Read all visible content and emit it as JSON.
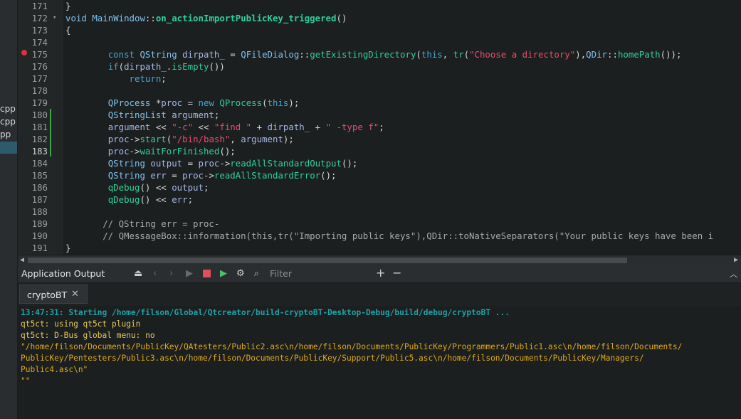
{
  "sidebar": {
    "items": [
      "cpp",
      "cpp",
      "pp",
      ""
    ]
  },
  "editor": {
    "lines": [
      {
        "num": "171",
        "fold": "",
        "tokens": [
          [
            "o",
            "}"
          ]
        ]
      },
      {
        "num": "172",
        "fold": "▾",
        "tokens": [
          [
            "t",
            "void"
          ],
          [
            "o",
            " "
          ],
          [
            "t",
            "MainWindow"
          ],
          [
            "o",
            "::"
          ],
          [
            "fb",
            "on_actionImportPublicKey_triggered"
          ],
          [
            "o",
            "()"
          ]
        ]
      },
      {
        "num": "173",
        "fold": "",
        "tokens": [
          [
            "o",
            "{"
          ]
        ]
      },
      {
        "num": "174",
        "fold": "",
        "tokens": []
      },
      {
        "num": "175",
        "fold": "",
        "tokens": [
          [
            "o",
            "        "
          ],
          [
            "k",
            "const"
          ],
          [
            "o",
            " "
          ],
          [
            "t",
            "QString"
          ],
          [
            "o",
            " "
          ],
          [
            "v",
            "dirpath_"
          ],
          [
            "o",
            " = "
          ],
          [
            "t",
            "QFileDialog"
          ],
          [
            "o",
            "::"
          ],
          [
            "f",
            "getExistingDirectory"
          ],
          [
            "o",
            "("
          ],
          [
            "k",
            "this"
          ],
          [
            "o",
            ", "
          ],
          [
            "f",
            "tr"
          ],
          [
            "o",
            "("
          ],
          [
            "s",
            "\"Choose a directory\""
          ],
          [
            "o",
            "),"
          ],
          [
            "t",
            "QDir"
          ],
          [
            "o",
            "::"
          ],
          [
            "f",
            "homePath"
          ],
          [
            "o",
            "());"
          ]
        ]
      },
      {
        "num": "176",
        "fold": "",
        "tokens": [
          [
            "o",
            "        "
          ],
          [
            "k",
            "if"
          ],
          [
            "o",
            "("
          ],
          [
            "v",
            "dirpath_"
          ],
          [
            "o",
            "."
          ],
          [
            "f",
            "isEmpty"
          ],
          [
            "o",
            "())"
          ]
        ]
      },
      {
        "num": "177",
        "fold": "",
        "tokens": [
          [
            "o",
            "            "
          ],
          [
            "k",
            "return"
          ],
          [
            "o",
            ";"
          ]
        ]
      },
      {
        "num": "178",
        "fold": "",
        "tokens": []
      },
      {
        "num": "179",
        "fold": "",
        "tokens": [
          [
            "o",
            "        "
          ],
          [
            "t",
            "QProcess"
          ],
          [
            "o",
            " *"
          ],
          [
            "v",
            "proc"
          ],
          [
            "o",
            " = "
          ],
          [
            "k",
            "new"
          ],
          [
            "o",
            " "
          ],
          [
            "f",
            "QProcess"
          ],
          [
            "o",
            "("
          ],
          [
            "k",
            "this"
          ],
          [
            "o",
            ");"
          ]
        ]
      },
      {
        "num": "180",
        "fold": "",
        "tokens": [
          [
            "o",
            "        "
          ],
          [
            "t",
            "QStringList"
          ],
          [
            "o",
            " "
          ],
          [
            "v",
            "argument"
          ],
          [
            "o",
            ";"
          ]
        ]
      },
      {
        "num": "181",
        "fold": "",
        "tokens": [
          [
            "o",
            "        "
          ],
          [
            "v",
            "argument"
          ],
          [
            "o",
            " << "
          ],
          [
            "s",
            "\"-c\""
          ],
          [
            "o",
            " << "
          ],
          [
            "s",
            "\"find \""
          ],
          [
            "o",
            " + "
          ],
          [
            "v",
            "dirpath_"
          ],
          [
            "o",
            " + "
          ],
          [
            "s",
            "\" -type f\""
          ],
          [
            "o",
            ";"
          ]
        ]
      },
      {
        "num": "182",
        "fold": "",
        "tokens": [
          [
            "o",
            "        "
          ],
          [
            "v",
            "proc"
          ],
          [
            "o",
            "->"
          ],
          [
            "f",
            "start"
          ],
          [
            "o",
            "("
          ],
          [
            "s",
            "\"/bin/bash\""
          ],
          [
            "o",
            ", "
          ],
          [
            "v",
            "argument"
          ],
          [
            "o",
            ");"
          ]
        ]
      },
      {
        "num": "183",
        "fold": "",
        "tokens": [
          [
            "o",
            "        "
          ],
          [
            "v",
            "proc"
          ],
          [
            "o",
            "->"
          ],
          [
            "f",
            "waitForFinished"
          ],
          [
            "o",
            "();"
          ]
        ]
      },
      {
        "num": "184",
        "fold": "",
        "tokens": [
          [
            "o",
            "        "
          ],
          [
            "t",
            "QString"
          ],
          [
            "o",
            " "
          ],
          [
            "v",
            "output"
          ],
          [
            "o",
            " = "
          ],
          [
            "v",
            "proc"
          ],
          [
            "o",
            "->"
          ],
          [
            "f",
            "readAllStandardOutput"
          ],
          [
            "o",
            "();"
          ]
        ]
      },
      {
        "num": "185",
        "fold": "",
        "tokens": [
          [
            "o",
            "        "
          ],
          [
            "t",
            "QString"
          ],
          [
            "o",
            " "
          ],
          [
            "v",
            "err"
          ],
          [
            "o",
            " = "
          ],
          [
            "v",
            "proc"
          ],
          [
            "o",
            "->"
          ],
          [
            "f",
            "readAllStandardError"
          ],
          [
            "o",
            "();"
          ]
        ]
      },
      {
        "num": "186",
        "fold": "",
        "tokens": [
          [
            "o",
            "        "
          ],
          [
            "f",
            "qDebug"
          ],
          [
            "o",
            "() << "
          ],
          [
            "v",
            "output"
          ],
          [
            "o",
            ";"
          ]
        ]
      },
      {
        "num": "187",
        "fold": "",
        "tokens": [
          [
            "o",
            "        "
          ],
          [
            "f",
            "qDebug"
          ],
          [
            "o",
            "() << "
          ],
          [
            "v",
            "err"
          ],
          [
            "o",
            ";"
          ]
        ]
      },
      {
        "num": "188",
        "fold": "",
        "tokens": []
      },
      {
        "num": "189",
        "fold": "",
        "tokens": [
          [
            "o",
            "       "
          ],
          [
            "c",
            "// QString err = proc-"
          ]
        ]
      },
      {
        "num": "190",
        "fold": "",
        "tokens": [
          [
            "o",
            "       "
          ],
          [
            "c",
            "// QMessageBox::information(this,tr(\"Importing public keys\"),QDir::toNativeSeparators(\"Your public keys have been i"
          ]
        ]
      },
      {
        "num": "191",
        "fold": "",
        "tokens": [
          [
            "o",
            "}"
          ]
        ]
      }
    ]
  },
  "output_panel": {
    "title": "Application Output",
    "filter_placeholder": "Filter",
    "tab_label": "cryptoBT",
    "close_glyph": "✕",
    "lines": [
      {
        "cls": "o-start",
        "text": "13:47:31: Starting /home/filson/Global/Qtcreator/build-cryptoBT-Desktop-Debug/build/debug/cryptoBT ..."
      },
      {
        "cls": "o-norm",
        "text": "qt5ct: using qt5ct plugin"
      },
      {
        "cls": "o-norm",
        "text": "qt5ct: D-Bus global menu: no"
      },
      {
        "cls": "o-res",
        "text": "\"/home/filson/Documents/PublicKey/QAtesters/Public2.asc\\n/home/filson/Documents/PublicKey/Programmers/Public1.asc\\n/home/filson/Documents/"
      },
      {
        "cls": "o-res",
        "text": "PublicKey/Pentesters/Public3.asc\\n/home/filson/Documents/PublicKey/Support/Public5.asc\\n/home/filson/Documents/PublicKey/Managers/"
      },
      {
        "cls": "o-res",
        "text": "Public4.asc\\n\""
      },
      {
        "cls": "o-res",
        "text": "\"\""
      }
    ]
  }
}
